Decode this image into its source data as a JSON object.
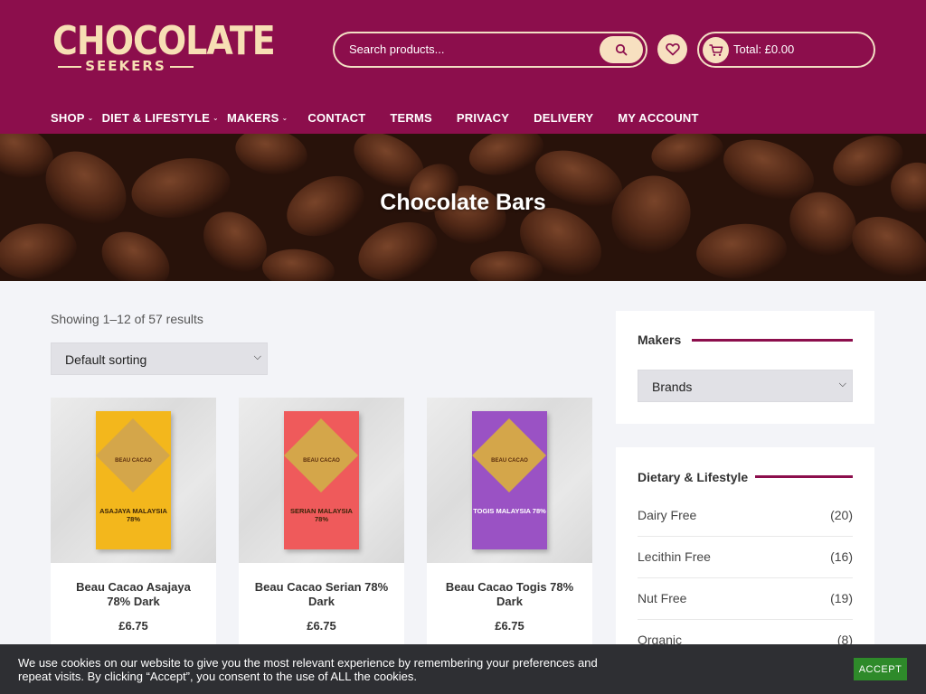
{
  "header": {
    "logo_top": "CHOCOLATE",
    "logo_bottom": "SEEKERS",
    "search_placeholder": "Search products...",
    "search_icon": "search-icon",
    "wishlist_icon": "heart-icon",
    "cart_icon": "cart-icon",
    "cart_total": "Total: £0.00",
    "colors": {
      "brand": "#8c0e4c",
      "accent": "#f7e0c0"
    }
  },
  "nav": {
    "items": [
      {
        "label": "SHOP",
        "has_submenu": true
      },
      {
        "label": "DIET & LIFESTYLE",
        "has_submenu": true
      },
      {
        "label": "MAKERS",
        "has_submenu": true
      },
      {
        "label": "CONTACT",
        "has_submenu": false
      },
      {
        "label": "TERMS",
        "has_submenu": false
      },
      {
        "label": "PRIVACY",
        "has_submenu": false
      },
      {
        "label": "DELIVERY",
        "has_submenu": false
      },
      {
        "label": "MY ACCOUNT",
        "has_submenu": false
      }
    ]
  },
  "hero": {
    "title": "Chocolate Bars"
  },
  "shop": {
    "results_text": "Showing 1–12 of 57 results",
    "sort_selected": "Default sorting",
    "products": [
      {
        "name": "Beau Cacao Asajaya 78% Dark",
        "price": "£6.75",
        "pack_brand": "BEAU CACAO",
        "pack_origin": "ASAJAYA MALAYSIA 78%",
        "pack_color": "#f3b71c",
        "pack_color2": "#e9a114"
      },
      {
        "name": "Beau Cacao Serian 78% Dark",
        "price": "£6.75",
        "pack_brand": "BEAU CACAO",
        "pack_origin": "SERIAN MALAYSIA 78%",
        "pack_color": "#ef5a5b",
        "pack_color2": "#e2474a"
      },
      {
        "name": "Beau Cacao Togis 78% Dark",
        "price": "£6.75",
        "pack_brand": "BEAU CACAO",
        "pack_origin": "TOGIS MALAYSIA 78%",
        "pack_color": "#9a52c4",
        "pack_color2": "#8442b0"
      }
    ]
  },
  "sidebar": {
    "makers": {
      "title": "Makers",
      "select_selected": "Brands"
    },
    "diet": {
      "title": "Dietary & Lifestyle",
      "items": [
        {
          "name": "Dairy Free",
          "count": "(20)"
        },
        {
          "name": "Lecithin Free",
          "count": "(16)"
        },
        {
          "name": "Nut Free",
          "count": "(19)"
        },
        {
          "name": "Organic",
          "count": "(8)"
        }
      ]
    }
  },
  "cookie": {
    "text": "We use cookies on our website to give you the most relevant experience by remembering your preferences and repeat visits. By clicking “Accept”, you consent to the use of ALL the cookies.",
    "accept_label": "ACCEPT"
  }
}
